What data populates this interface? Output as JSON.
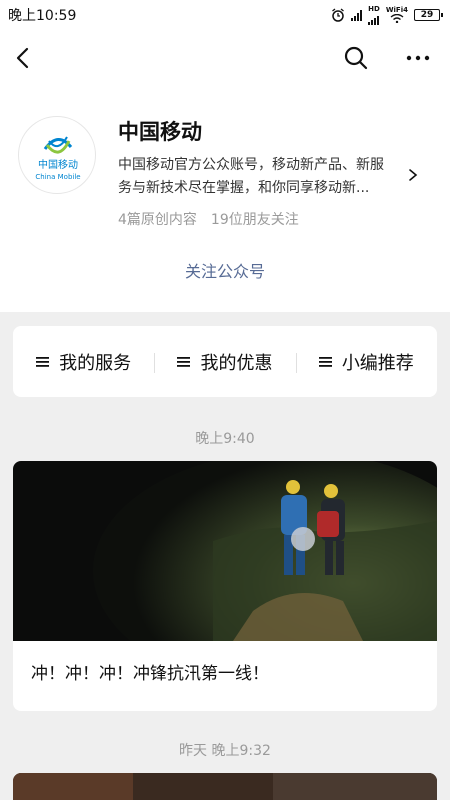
{
  "status_bar": {
    "time": "晚上10:59",
    "network_hd": "HD",
    "wifi_label": "WiFi4",
    "battery": "29"
  },
  "nav": {
    "icons": [
      "back-arrow-icon",
      "search-icon",
      "more-icon"
    ]
  },
  "account": {
    "name": "中国移动",
    "logo_text_cn": "中国移动",
    "logo_text_en": "China Mobile",
    "description_line1": "中国移动官方公众账号，移动新产品、新服",
    "description_line2": "务与新技术尽在掌握，和你同享移动新...",
    "original_count": "4篇原创内容",
    "friends_following": "19位朋友关注",
    "follow_label": "关注公众号"
  },
  "menu": {
    "items": [
      {
        "label": "我的服务"
      },
      {
        "label": "我的优惠"
      },
      {
        "label": "小编推荐"
      }
    ]
  },
  "feed": {
    "posts": [
      {
        "time": "晚上9:40",
        "title": "冲！冲！冲！冲锋抗汛第一线！"
      },
      {
        "time": "昨天 晚上9:32"
      }
    ]
  },
  "colors": {
    "brand_blue": "#0085d0",
    "link_blue": "#576b95",
    "background": "#efefef"
  }
}
